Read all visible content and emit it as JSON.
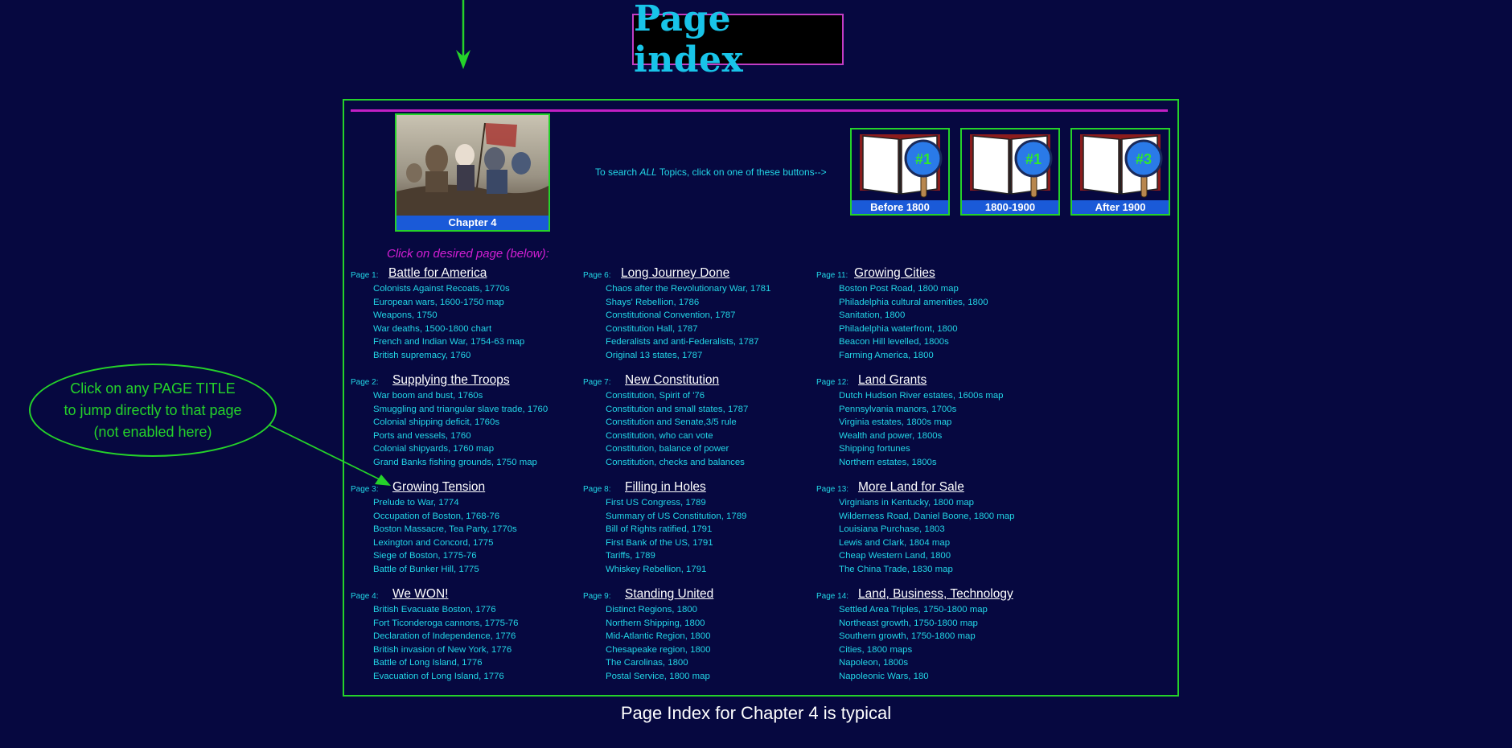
{
  "header": {
    "title": "Page index"
  },
  "chapter": {
    "caption": "Chapter 4"
  },
  "search": {
    "hint_pre": "To search ",
    "hint_em": "ALL",
    "hint_post": " Topics, click on one of these buttons-->"
  },
  "era_buttons": [
    {
      "label": "Before 1800",
      "badge": "#1"
    },
    {
      "label": "1800-1900",
      "badge": "#1"
    },
    {
      "label": "After 1900",
      "badge": "#3"
    }
  ],
  "click_hint": "Click on desired page (below):",
  "pages": [
    {
      "num": "Page 1:",
      "title": "Battle for America",
      "topics": [
        "Colonists Against Recoats, 1770s",
        "European wars, 1600-1750 map",
        "Weapons, 1750",
        "War deaths, 1500-1800 chart",
        "French and Indian War, 1754-63 map",
        "British supremacy, 1760"
      ]
    },
    {
      "num": "Page 2:",
      "title": "Supplying the Troops",
      "topics": [
        "War boom and bust, 1760s",
        "Smuggling and triangular slave trade, 1760",
        "Colonial shipping deficit, 1760s",
        "Ports and vessels, 1760",
        "Colonial shipyards, 1760 map",
        "Grand Banks fishing grounds, 1750 map"
      ]
    },
    {
      "num": "Page 3:",
      "title": "Growing Tension",
      "topics": [
        "Prelude to War, 1774",
        "Occupation of Boston, 1768-76",
        "Boston Massacre, Tea Party, 1770s",
        "Lexington and Concord, 1775",
        "Siege of Boston, 1775-76",
        "Battle of Bunker Hill, 1775"
      ]
    },
    {
      "num": "Page 4:",
      "title": "We WON!",
      "topics": [
        "British Evacuate Boston, 1776",
        "Fort Ticonderoga cannons, 1775-76",
        "Declaration of Independence, 1776",
        "British invasion of New York, 1776",
        "Battle of Long Island, 1776",
        "Evacuation of Long Island, 1776"
      ]
    },
    {
      "num": "Page 6:",
      "title": "Long Journey Done",
      "topics": [
        "Chaos after the Revolutionary War, 1781",
        "Shays' Rebellion, 1786",
        "Constitutional Convention, 1787",
        "Constitution Hall, 1787",
        "Federalists and anti-Federalists, 1787",
        "Original 13 states, 1787"
      ]
    },
    {
      "num": "Page 7:",
      "title": "New Constitution",
      "topics": [
        "Constitution, Spirit of '76",
        "Constitution and small states, 1787",
        "Constitution and Senate,3/5 rule",
        "Constitution, who can vote",
        "Constitution, balance of power",
        "Constitution, checks and balances"
      ]
    },
    {
      "num": "Page 8:",
      "title": "Filling in Holes",
      "topics": [
        "First US Congress, 1789",
        "Summary of US Constitution, 1789",
        "Bill of Rights ratified, 1791",
        "First Bank of the US, 1791",
        "Tariffs, 1789",
        "Whiskey Rebellion, 1791"
      ]
    },
    {
      "num": "Page 9:",
      "title": "Standing United",
      "topics": [
        "Distinct Regions, 1800",
        "Northern Shipping, 1800",
        "Mid-Atlantic Region, 1800",
        "Chesapeake region, 1800",
        "The Carolinas, 1800",
        "Postal Service, 1800 map"
      ]
    },
    {
      "num": "Page 11:",
      "title": "Growing Cities",
      "topics": [
        "Boston Post Road, 1800 map",
        "Philadelphia cultural amenities, 1800",
        "Sanitation, 1800",
        "Philadelphia waterfront, 1800",
        "Beacon Hill levelled, 1800s",
        "Farming America, 1800"
      ]
    },
    {
      "num": "Page 12:",
      "title": "Land Grants",
      "topics": [
        "Dutch Hudson River estates, 1600s map",
        "Pennsylvania manors, 1700s",
        "Virginia estates, 1800s map",
        "Wealth and power, 1800s",
        "Shipping fortunes",
        "Northern estates, 1800s"
      ]
    },
    {
      "num": "Page 13:",
      "title": "More Land for Sale",
      "topics": [
        "Virginians in Kentucky, 1800 map",
        "Wilderness Road, Daniel Boone, 1800 map",
        "Louisiana Purchase, 1803",
        "Lewis and Clark, 1804 map",
        "Cheap Western Land, 1800",
        "The China Trade, 1830 map"
      ]
    },
    {
      "num": "Page 14:",
      "title": "Land, Business, Technology",
      "topics": [
        "Settled Area Triples, 1750-1800 map",
        "Northeast growth, 1750-1800 map",
        "Southern growth, 1750-1800 map",
        "Cities, 1800 maps",
        "Napoleon, 1800s",
        "Napoleonic Wars, 180"
      ]
    }
  ],
  "annotation": {
    "line1": "Click on any PAGE TITLE",
    "line2": "to jump directly to that page",
    "line3": "(not enabled here)"
  },
  "footer": {
    "caption": "Page Index for Chapter 4 is typical"
  },
  "colors": {
    "background": "#060840",
    "border_green": "#25d22a",
    "accent_magenta": "#c21fc4",
    "topic_cyan": "#22d6e6",
    "title_cyan": "#18c4e8"
  }
}
